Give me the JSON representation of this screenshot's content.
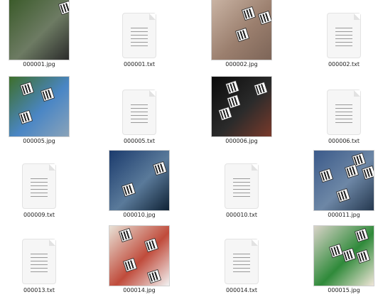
{
  "files": [
    {
      "name": "000001.jpg",
      "kind": "image",
      "colors": [
        "#3b5b2a",
        "#6d7b63",
        "#2b2b2b"
      ]
    },
    {
      "name": "000001.txt",
      "kind": "text"
    },
    {
      "name": "000002.jpg",
      "kind": "image",
      "colors": [
        "#c9b3a3",
        "#9b7f6e",
        "#7d6558"
      ]
    },
    {
      "name": "000002.txt",
      "kind": "text"
    },
    {
      "name": "000005.jpg",
      "kind": "image",
      "colors": [
        "#3e6f2b",
        "#4a86c5",
        "#8aa3b9"
      ]
    },
    {
      "name": "000005.txt",
      "kind": "text"
    },
    {
      "name": "000006.jpg",
      "kind": "image",
      "colors": [
        "#0b0b0b",
        "#2b2b2b",
        "#7a3a2b"
      ]
    },
    {
      "name": "000006.txt",
      "kind": "text"
    },
    {
      "name": "000009.txt",
      "kind": "text"
    },
    {
      "name": "000010.jpg",
      "kind": "image",
      "colors": [
        "#1b3b6d",
        "#5a7a9a",
        "#0f2235"
      ]
    },
    {
      "name": "000010.txt",
      "kind": "text"
    },
    {
      "name": "000011.jpg",
      "kind": "image",
      "colors": [
        "#3b5a8a",
        "#6d87a6",
        "#25384f"
      ]
    },
    {
      "name": "000013.txt",
      "kind": "text"
    },
    {
      "name": "000014.jpg",
      "kind": "image",
      "colors": [
        "#e8e1d6",
        "#c04b3b",
        "#f2f2f2"
      ]
    },
    {
      "name": "000014.txt",
      "kind": "text"
    },
    {
      "name": "000015.jpg",
      "kind": "image",
      "colors": [
        "#d9d3c8",
        "#2f8a3a",
        "#f0e6d8"
      ]
    }
  ],
  "icons": {
    "text_file_icon": "document-lines-icon",
    "qr_marker_icon": "qr-code-icon"
  }
}
